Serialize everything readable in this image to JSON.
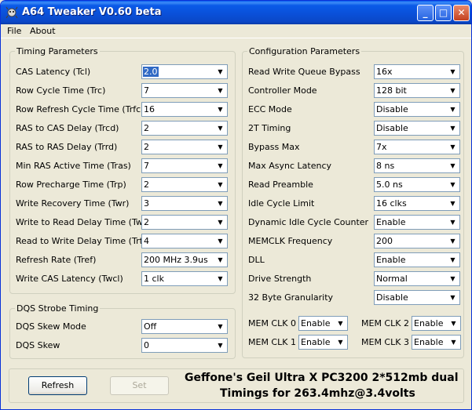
{
  "window": {
    "title": "A64 Tweaker V0.60 beta",
    "controls": {
      "minimize": "_",
      "maximize": "□",
      "close": "✕"
    }
  },
  "menu": [
    "File",
    "About"
  ],
  "timing": {
    "title": "Timing Parameters",
    "rows": [
      {
        "label": "CAS Latency (Tcl)",
        "value": "2.0"
      },
      {
        "label": "Row Cycle Time (Trc)",
        "value": "7"
      },
      {
        "label": "Row Refresh Cycle Time (Trfc)",
        "value": "16"
      },
      {
        "label": "RAS to CAS Delay (Trcd)",
        "value": "2"
      },
      {
        "label": "RAS to RAS Delay (Trrd)",
        "value": "2"
      },
      {
        "label": "Min RAS Active Time (Tras)",
        "value": "7"
      },
      {
        "label": "Row Precharge Time (Trp)",
        "value": "2"
      },
      {
        "label": "Write Recovery Time (Twr)",
        "value": "3"
      },
      {
        "label": "Write to Read Delay Time (Twtr)",
        "value": "2"
      },
      {
        "label": "Read to Write Delay Time (Trtw)",
        "value": "4"
      },
      {
        "label": "Refresh Rate (Tref)",
        "value": "200 MHz 3.9us"
      },
      {
        "label": "Write CAS Latency (Twcl)",
        "value": "1 clk"
      }
    ]
  },
  "dqs": {
    "title": "DQS Strobe Timing",
    "rows": [
      {
        "label": "DQS Skew Mode",
        "value": "Off"
      },
      {
        "label": "DQS Skew",
        "value": "0"
      }
    ]
  },
  "config": {
    "title": "Configuration Parameters",
    "rows": [
      {
        "label": "Read Write Queue Bypass",
        "value": "16x"
      },
      {
        "label": "Controller Mode",
        "value": "128 bit"
      },
      {
        "label": "ECC Mode",
        "value": "Disable"
      },
      {
        "label": "2T Timing",
        "value": "Disable"
      },
      {
        "label": "Bypass Max",
        "value": "7x"
      },
      {
        "label": "Max Async Latency",
        "value": "8 ns"
      },
      {
        "label": "Read Preamble",
        "value": "5.0 ns"
      },
      {
        "label": "Idle Cycle Limit",
        "value": "16 clks"
      },
      {
        "label": "Dynamic Idle Cycle Counter",
        "value": "Enable"
      },
      {
        "label": "MEMCLK Frequency",
        "value": "200"
      },
      {
        "label": "DLL",
        "value": "Enable"
      },
      {
        "label": "Drive Strength",
        "value": "Normal"
      },
      {
        "label": "32 Byte Granularity",
        "value": "Disable"
      }
    ],
    "memclk": [
      {
        "label": "MEM CLK 0",
        "value": "Enable"
      },
      {
        "label": "MEM CLK 2",
        "value": "Enable"
      },
      {
        "label": "MEM CLK 1",
        "value": "Enable"
      },
      {
        "label": "MEM CLK 3",
        "value": "Enable"
      }
    ]
  },
  "buttons": {
    "refresh": "Refresh",
    "set": "Set"
  },
  "caption": {
    "line1": "Geffone's Geil Ultra X PC3200 2*512mb dual",
    "line2": "Timings for 263.4mhz@3.4volts"
  },
  "colors": {
    "titlebar": "#0a4fd7",
    "window_bg": "#ece9d8",
    "selection": "#316ac5"
  }
}
